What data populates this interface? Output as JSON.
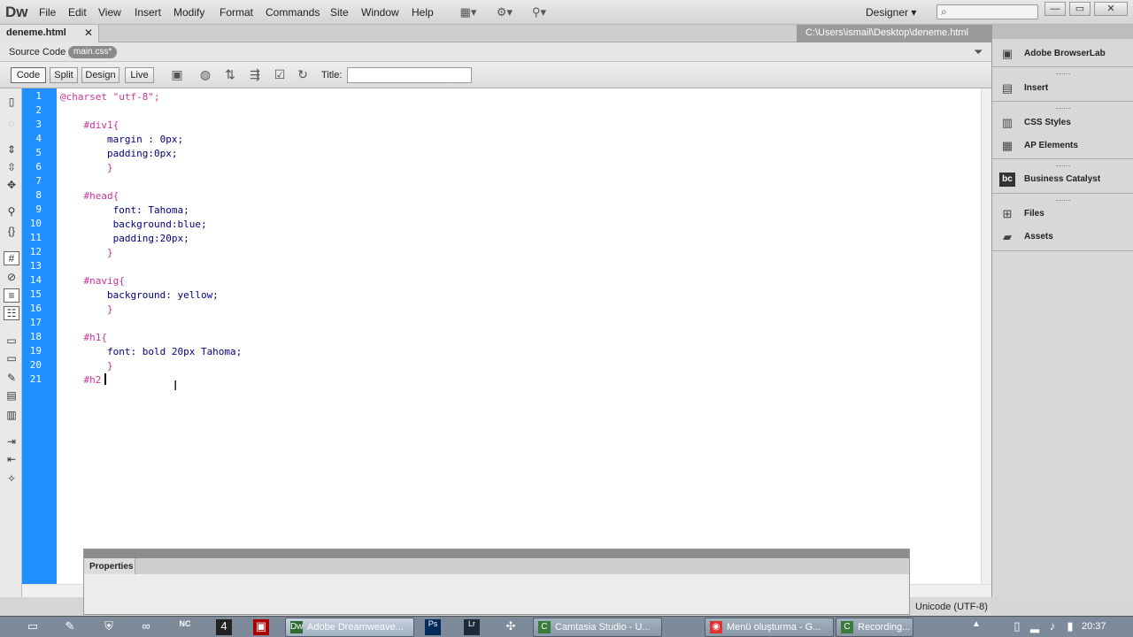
{
  "app": {
    "logo": "Dw"
  },
  "menu": [
    "File",
    "Edit",
    "View",
    "Insert",
    "Modify",
    "Format",
    "Commands",
    "Site",
    "Window",
    "Help"
  ],
  "toolbar_icons": [
    "layout-icon",
    "gear-icon",
    "site-icon"
  ],
  "workspace": {
    "label": "Designer",
    "arrow": "▾"
  },
  "search": {
    "icon": "⌕"
  },
  "window_controls": {
    "minimize": "—",
    "restore": "▭",
    "close": "✕"
  },
  "document": {
    "tab": "deneme.html",
    "close": "✕",
    "path": "C:\\Users\\ismail\\Desktop\\deneme.html"
  },
  "related": {
    "source": "Source Code",
    "css": "main.css*"
  },
  "views": {
    "code": "Code",
    "split": "Split",
    "design": "Design",
    "live": "Live"
  },
  "doc_title": {
    "label": "Title:",
    "value": ""
  },
  "code_lines": [
    {
      "n": "1",
      "text": "@charset \"utf-8\";"
    },
    {
      "n": "2",
      "text": ""
    },
    {
      "n": "3",
      "text": "    #div1{"
    },
    {
      "n": "4",
      "text": "        margin : 0px;"
    },
    {
      "n": "5",
      "text": "        padding:0px;"
    },
    {
      "n": "6",
      "text": "        }"
    },
    {
      "n": "7",
      "text": ""
    },
    {
      "n": "8",
      "text": "    #head{"
    },
    {
      "n": "9",
      "text": "         font: Tahoma;"
    },
    {
      "n": "10",
      "text": "         background:blue;"
    },
    {
      "n": "11",
      "text": "         padding:20px;"
    },
    {
      "n": "12",
      "text": "        }"
    },
    {
      "n": "13",
      "text": ""
    },
    {
      "n": "14",
      "text": "    #navig{"
    },
    {
      "n": "15",
      "text": "        background: yellow;"
    },
    {
      "n": "16",
      "text": "        }"
    },
    {
      "n": "17",
      "text": ""
    },
    {
      "n": "18",
      "text": "    #h1{"
    },
    {
      "n": "19",
      "text": "        font: bold 20px Tahoma;"
    },
    {
      "n": "20",
      "text": "        }"
    },
    {
      "n": "21",
      "text": "    #h2"
    }
  ],
  "properties": {
    "label": "Properties"
  },
  "status": {
    "encoding": "Unicode (UTF-8)"
  },
  "panels": [
    {
      "label": "Adobe BrowserLab",
      "icon": "browserlab-icon"
    },
    {
      "label": "Insert",
      "icon": "insert-icon"
    },
    {
      "label": "CSS Styles",
      "icon": "css-styles-icon"
    },
    {
      "label": "AP Elements",
      "icon": "ap-elements-icon"
    },
    {
      "label": "Business Catalyst",
      "icon": "business-catalyst-icon"
    },
    {
      "label": "Files",
      "icon": "files-icon"
    },
    {
      "label": "Assets",
      "icon": "assets-icon"
    }
  ],
  "taskbar": {
    "tasks": [
      {
        "label": "Adobe Dreamweave...",
        "active": true
      },
      {
        "label": "Camtasia Studio - U...",
        "active": false
      },
      {
        "label": "Menü oluşturma - G...",
        "active": false
      },
      {
        "label": "Recording...",
        "active": false
      }
    ],
    "clock": "20:37"
  },
  "colors": {
    "gutter": "#1e90ff",
    "selector": "#cc3399",
    "property": "#000080"
  }
}
